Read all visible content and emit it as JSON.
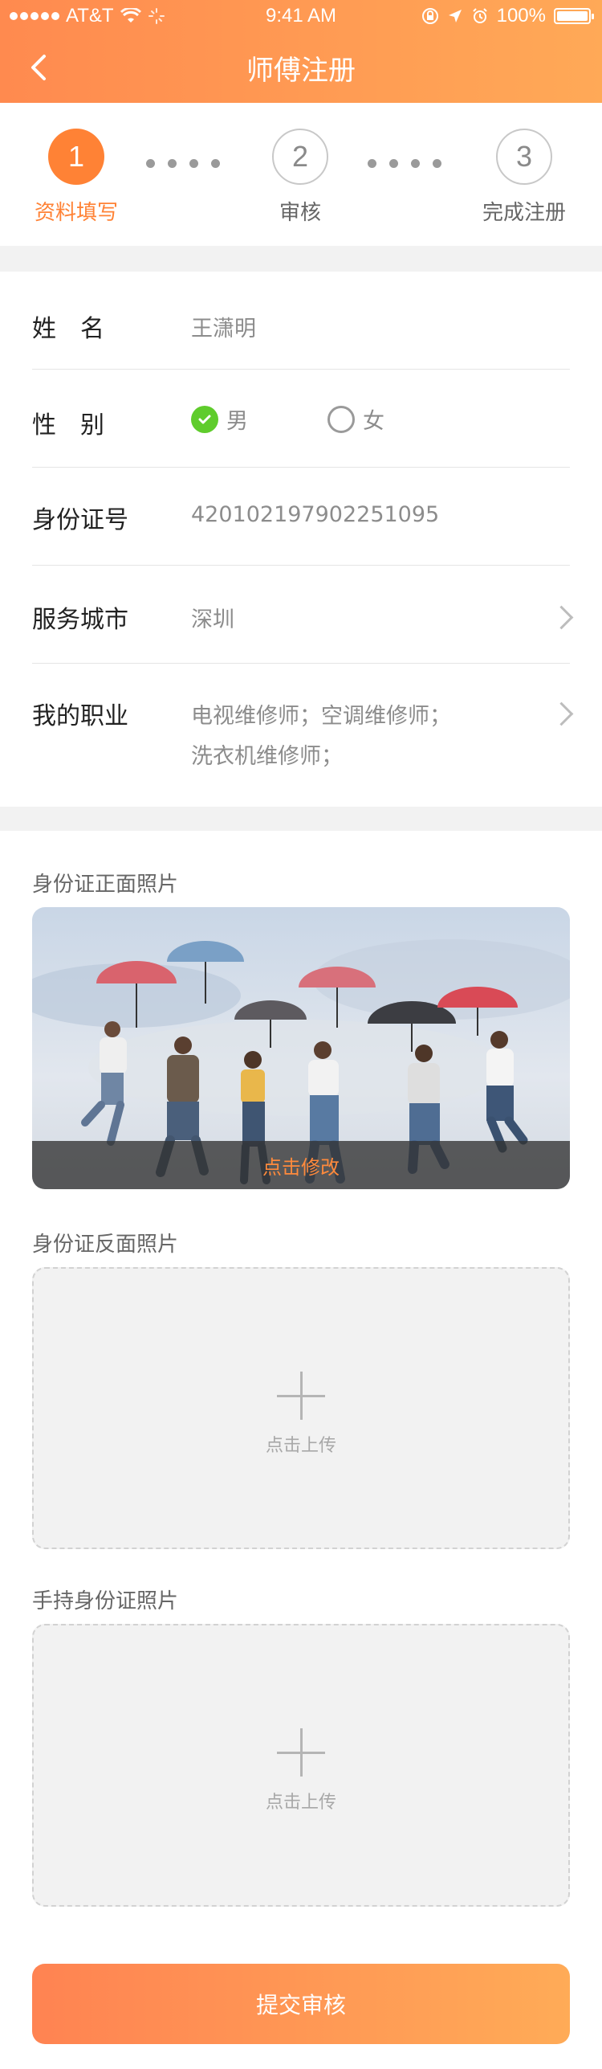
{
  "status_bar": {
    "carrier": "AT&T",
    "time": "9:41 AM",
    "battery": "100%"
  },
  "nav": {
    "title": "师傅注册"
  },
  "steps": [
    {
      "number": "1",
      "label": "资料填写",
      "state": "active"
    },
    {
      "number": "2",
      "label": "审核",
      "state": "inactive"
    },
    {
      "number": "3",
      "label": "完成注册",
      "state": "inactive"
    }
  ],
  "form": {
    "name": {
      "label": "姓　名",
      "value": "王潇明"
    },
    "gender": {
      "label": "性　别",
      "options": [
        "男",
        "女"
      ],
      "selected": "男"
    },
    "id_number": {
      "label": "身份证号",
      "value": "420102197902251095"
    },
    "city": {
      "label": "服务城市",
      "value": "深圳"
    },
    "profession": {
      "label": "我的职业",
      "value_line1": "电视维修师；空调维修师；",
      "value_line2": "洗衣机维修师；"
    }
  },
  "photos": {
    "front": {
      "title": "身份证正面照片",
      "overlay": "点击修改"
    },
    "back": {
      "title": "身份证反面照片",
      "upload_text": "点击上传"
    },
    "handheld": {
      "title": "手持身份证照片",
      "upload_text": "点击上传"
    }
  },
  "submit_label": "提交审核",
  "colors": {
    "accent": "#ff8235",
    "radio_checked": "#5fcc2c"
  }
}
